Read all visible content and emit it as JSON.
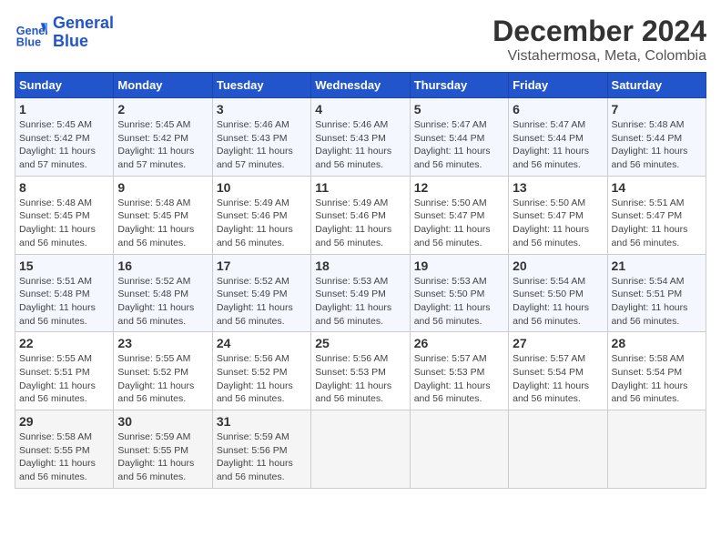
{
  "header": {
    "logo_line1": "General",
    "logo_line2": "Blue",
    "main_title": "December 2024",
    "subtitle": "Vistahermosa, Meta, Colombia"
  },
  "calendar": {
    "weekdays": [
      "Sunday",
      "Monday",
      "Tuesday",
      "Wednesday",
      "Thursday",
      "Friday",
      "Saturday"
    ],
    "weeks": [
      [
        {
          "day": "1",
          "info": "Sunrise: 5:45 AM\nSunset: 5:42 PM\nDaylight: 11 hours\nand 57 minutes."
        },
        {
          "day": "2",
          "info": "Sunrise: 5:45 AM\nSunset: 5:42 PM\nDaylight: 11 hours\nand 57 minutes."
        },
        {
          "day": "3",
          "info": "Sunrise: 5:46 AM\nSunset: 5:43 PM\nDaylight: 11 hours\nand 57 minutes."
        },
        {
          "day": "4",
          "info": "Sunrise: 5:46 AM\nSunset: 5:43 PM\nDaylight: 11 hours\nand 56 minutes."
        },
        {
          "day": "5",
          "info": "Sunrise: 5:47 AM\nSunset: 5:44 PM\nDaylight: 11 hours\nand 56 minutes."
        },
        {
          "day": "6",
          "info": "Sunrise: 5:47 AM\nSunset: 5:44 PM\nDaylight: 11 hours\nand 56 minutes."
        },
        {
          "day": "7",
          "info": "Sunrise: 5:48 AM\nSunset: 5:44 PM\nDaylight: 11 hours\nand 56 minutes."
        }
      ],
      [
        {
          "day": "8",
          "info": "Sunrise: 5:48 AM\nSunset: 5:45 PM\nDaylight: 11 hours\nand 56 minutes."
        },
        {
          "day": "9",
          "info": "Sunrise: 5:48 AM\nSunset: 5:45 PM\nDaylight: 11 hours\nand 56 minutes."
        },
        {
          "day": "10",
          "info": "Sunrise: 5:49 AM\nSunset: 5:46 PM\nDaylight: 11 hours\nand 56 minutes."
        },
        {
          "day": "11",
          "info": "Sunrise: 5:49 AM\nSunset: 5:46 PM\nDaylight: 11 hours\nand 56 minutes."
        },
        {
          "day": "12",
          "info": "Sunrise: 5:50 AM\nSunset: 5:47 PM\nDaylight: 11 hours\nand 56 minutes."
        },
        {
          "day": "13",
          "info": "Sunrise: 5:50 AM\nSunset: 5:47 PM\nDaylight: 11 hours\nand 56 minutes."
        },
        {
          "day": "14",
          "info": "Sunrise: 5:51 AM\nSunset: 5:47 PM\nDaylight: 11 hours\nand 56 minutes."
        }
      ],
      [
        {
          "day": "15",
          "info": "Sunrise: 5:51 AM\nSunset: 5:48 PM\nDaylight: 11 hours\nand 56 minutes."
        },
        {
          "day": "16",
          "info": "Sunrise: 5:52 AM\nSunset: 5:48 PM\nDaylight: 11 hours\nand 56 minutes."
        },
        {
          "day": "17",
          "info": "Sunrise: 5:52 AM\nSunset: 5:49 PM\nDaylight: 11 hours\nand 56 minutes."
        },
        {
          "day": "18",
          "info": "Sunrise: 5:53 AM\nSunset: 5:49 PM\nDaylight: 11 hours\nand 56 minutes."
        },
        {
          "day": "19",
          "info": "Sunrise: 5:53 AM\nSunset: 5:50 PM\nDaylight: 11 hours\nand 56 minutes."
        },
        {
          "day": "20",
          "info": "Sunrise: 5:54 AM\nSunset: 5:50 PM\nDaylight: 11 hours\nand 56 minutes."
        },
        {
          "day": "21",
          "info": "Sunrise: 5:54 AM\nSunset: 5:51 PM\nDaylight: 11 hours\nand 56 minutes."
        }
      ],
      [
        {
          "day": "22",
          "info": "Sunrise: 5:55 AM\nSunset: 5:51 PM\nDaylight: 11 hours\nand 56 minutes."
        },
        {
          "day": "23",
          "info": "Sunrise: 5:55 AM\nSunset: 5:52 PM\nDaylight: 11 hours\nand 56 minutes."
        },
        {
          "day": "24",
          "info": "Sunrise: 5:56 AM\nSunset: 5:52 PM\nDaylight: 11 hours\nand 56 minutes."
        },
        {
          "day": "25",
          "info": "Sunrise: 5:56 AM\nSunset: 5:53 PM\nDaylight: 11 hours\nand 56 minutes."
        },
        {
          "day": "26",
          "info": "Sunrise: 5:57 AM\nSunset: 5:53 PM\nDaylight: 11 hours\nand 56 minutes."
        },
        {
          "day": "27",
          "info": "Sunrise: 5:57 AM\nSunset: 5:54 PM\nDaylight: 11 hours\nand 56 minutes."
        },
        {
          "day": "28",
          "info": "Sunrise: 5:58 AM\nSunset: 5:54 PM\nDaylight: 11 hours\nand 56 minutes."
        }
      ],
      [
        {
          "day": "29",
          "info": "Sunrise: 5:58 AM\nSunset: 5:55 PM\nDaylight: 11 hours\nand 56 minutes."
        },
        {
          "day": "30",
          "info": "Sunrise: 5:59 AM\nSunset: 5:55 PM\nDaylight: 11 hours\nand 56 minutes."
        },
        {
          "day": "31",
          "info": "Sunrise: 5:59 AM\nSunset: 5:56 PM\nDaylight: 11 hours\nand 56 minutes."
        },
        {
          "day": "",
          "info": ""
        },
        {
          "day": "",
          "info": ""
        },
        {
          "day": "",
          "info": ""
        },
        {
          "day": "",
          "info": ""
        }
      ]
    ]
  }
}
